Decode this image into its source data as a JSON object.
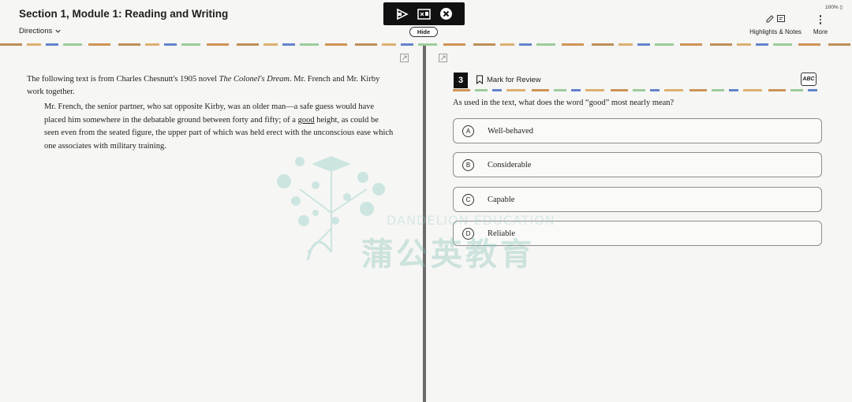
{
  "header": {
    "section_title": "Section 1, Module 1: Reading and Writing",
    "directions_label": "Directions",
    "hide_label": "Hide",
    "battery": "100% ▯",
    "highlights_label": "Highlights & Notes",
    "more_label": "More"
  },
  "passage": {
    "intro_part1": "The following text is from Charles Chesnutt's 1905 novel ",
    "intro_title": "The Colonel's Dream",
    "intro_part2": ". Mr. French and Mr. Kirby work together.",
    "body_part1": "Mr. French, the senior partner, who sat opposite Kirby, was an older man—a safe guess would have placed him somewhere in the debatable ground between forty and fifty; of a ",
    "body_underlined": "good",
    "body_part2": " height, as could be seen even from the seated figure, the upper part of which was held erect with the unconscious ease which one associates with military training."
  },
  "question": {
    "number": "3",
    "mark_review_label": "Mark for Review",
    "abc_label": "ABC",
    "prompt": "As used in the text, what does the word “good” most nearly mean?",
    "choices": [
      {
        "letter": "A",
        "text": "Well-behaved"
      },
      {
        "letter": "B",
        "text": "Considerable"
      },
      {
        "letter": "C",
        "text": "Capable"
      },
      {
        "letter": "D",
        "text": "Reliable"
      }
    ]
  },
  "watermark": {
    "english": "DANDELION EDUCATION",
    "chinese": "蒲公英教育"
  }
}
